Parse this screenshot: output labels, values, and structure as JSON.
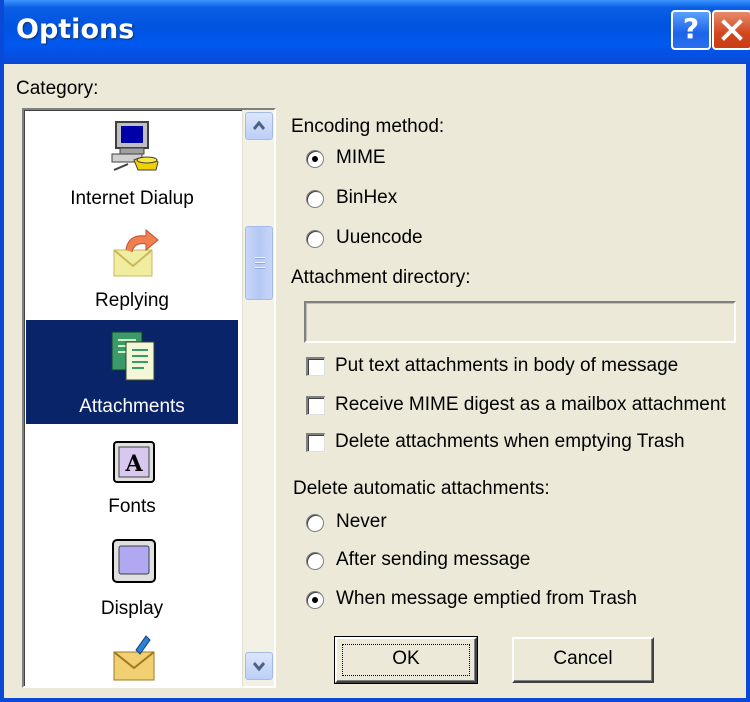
{
  "window": {
    "title": "Options",
    "help_label": "?"
  },
  "category": {
    "label": "Category:",
    "items": [
      {
        "label": "Internet Dialup",
        "icon": "computer-phone-icon",
        "selected": false
      },
      {
        "label": "Replying",
        "icon": "reply-envelope-icon",
        "selected": false
      },
      {
        "label": "Attachments",
        "icon": "attachment-icon",
        "selected": true
      },
      {
        "label": "Fonts",
        "icon": "font-icon",
        "selected": false
      },
      {
        "label": "Display",
        "icon": "display-icon",
        "selected": false
      },
      {
        "label": "",
        "icon": "mail-icon",
        "selected": false
      }
    ]
  },
  "encoding": {
    "label": "Encoding method:",
    "options": [
      "MIME",
      "BinHex",
      "Uuencode"
    ],
    "selected": "MIME"
  },
  "attachment_dir": {
    "label": "Attachment directory:",
    "value": ""
  },
  "checkboxes": [
    {
      "label": "Put text attachments in body of message",
      "checked": false
    },
    {
      "label": "Receive MIME digest as a mailbox attachment",
      "checked": false
    },
    {
      "label": "Delete attachments when emptying Trash",
      "checked": false
    }
  ],
  "delete_auto": {
    "label": "Delete automatic attachments:",
    "options": [
      "Never",
      "After sending message",
      "When message emptied from Trash"
    ],
    "selected": "When message emptied from Trash"
  },
  "buttons": {
    "ok": "OK",
    "cancel": "Cancel"
  },
  "colors": {
    "titlebar": "#0053e0",
    "selection": "#0a246a",
    "close": "#d2461e",
    "face": "#ece9d8"
  }
}
